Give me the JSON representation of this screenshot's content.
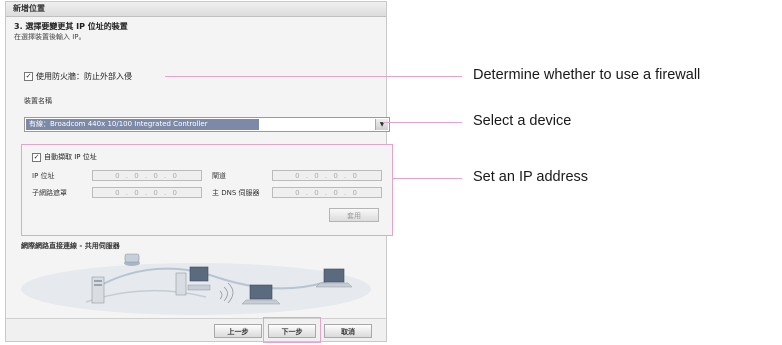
{
  "dialog": {
    "window_title": "新增位置",
    "step_title": "3. 選擇要變更其 IP 位址的裝置",
    "step_subtitle": "在選擇裝置後輸入 IP。",
    "firewall_checkbox_label": "使用防火牆：防止外部入侵",
    "firewall_checked": true,
    "device_label": "裝置名稱",
    "device_selected": "有線：Broadcom 440x 10/100 Integrated Controller",
    "auto_ip_label": "自動擷取 IP 位址",
    "auto_ip_checked": true,
    "ip_label": "IP 位址",
    "gateway_label": "閘道",
    "subnet_label": "子網路遮罩",
    "dns_label": "主 DNS 伺服器",
    "ip_value": "0 . 0 . 0 . 0",
    "gateway_value": "0 . 0 . 0 . 0",
    "subnet_value": "0 . 0 . 0 . 0",
    "dns_value": "0 . 0 . 0 . 0",
    "apply_label": "套用",
    "network_title": "網際網路直接連線 - 共用伺服器",
    "back_label": "上一步",
    "next_label": "下一步",
    "cancel_label": "取消"
  },
  "callouts": {
    "firewall": "Determine whether to use a firewall",
    "device": "Select a device",
    "ip": "Set an IP address"
  },
  "colors": {
    "highlight": "#e2a6cc",
    "selection": "#7c8aa8"
  }
}
